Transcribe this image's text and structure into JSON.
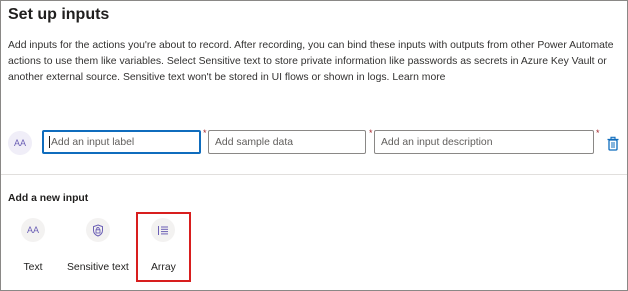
{
  "panel": {
    "title": "Set up inputs",
    "description": "Add inputs for the actions you're about to record. After recording, you can bind these inputs with outputs from other Power Automate actions to use them like variables. Select Sensitive text to store private information like passwords as secrets in Azure Key Vault or another external source. Sensitive text won't be stored in UI flows or shown in logs.",
    "learn_more": "Learn more"
  },
  "input_row": {
    "type_icon": "text-type-icon",
    "type_icon_glyph": "AA",
    "label_placeholder": "Add an input label",
    "sample_placeholder": "Add sample data",
    "description_placeholder": "Add an input description",
    "required_marker": "*",
    "delete_icon": "trash-icon"
  },
  "add_new": {
    "title": "Add a new input",
    "options": [
      {
        "label": "Text",
        "icon": "text-icon",
        "glyph": "AA"
      },
      {
        "label": "Sensitive text",
        "icon": "shield-lock-icon",
        "glyph": ""
      },
      {
        "label": "Array",
        "icon": "list-icon",
        "glyph": ""
      }
    ]
  },
  "colors": {
    "accent": "#0f6cbd",
    "highlight": "#d81e1e",
    "required": "#a4262c",
    "icon": "#6b5fb5"
  }
}
